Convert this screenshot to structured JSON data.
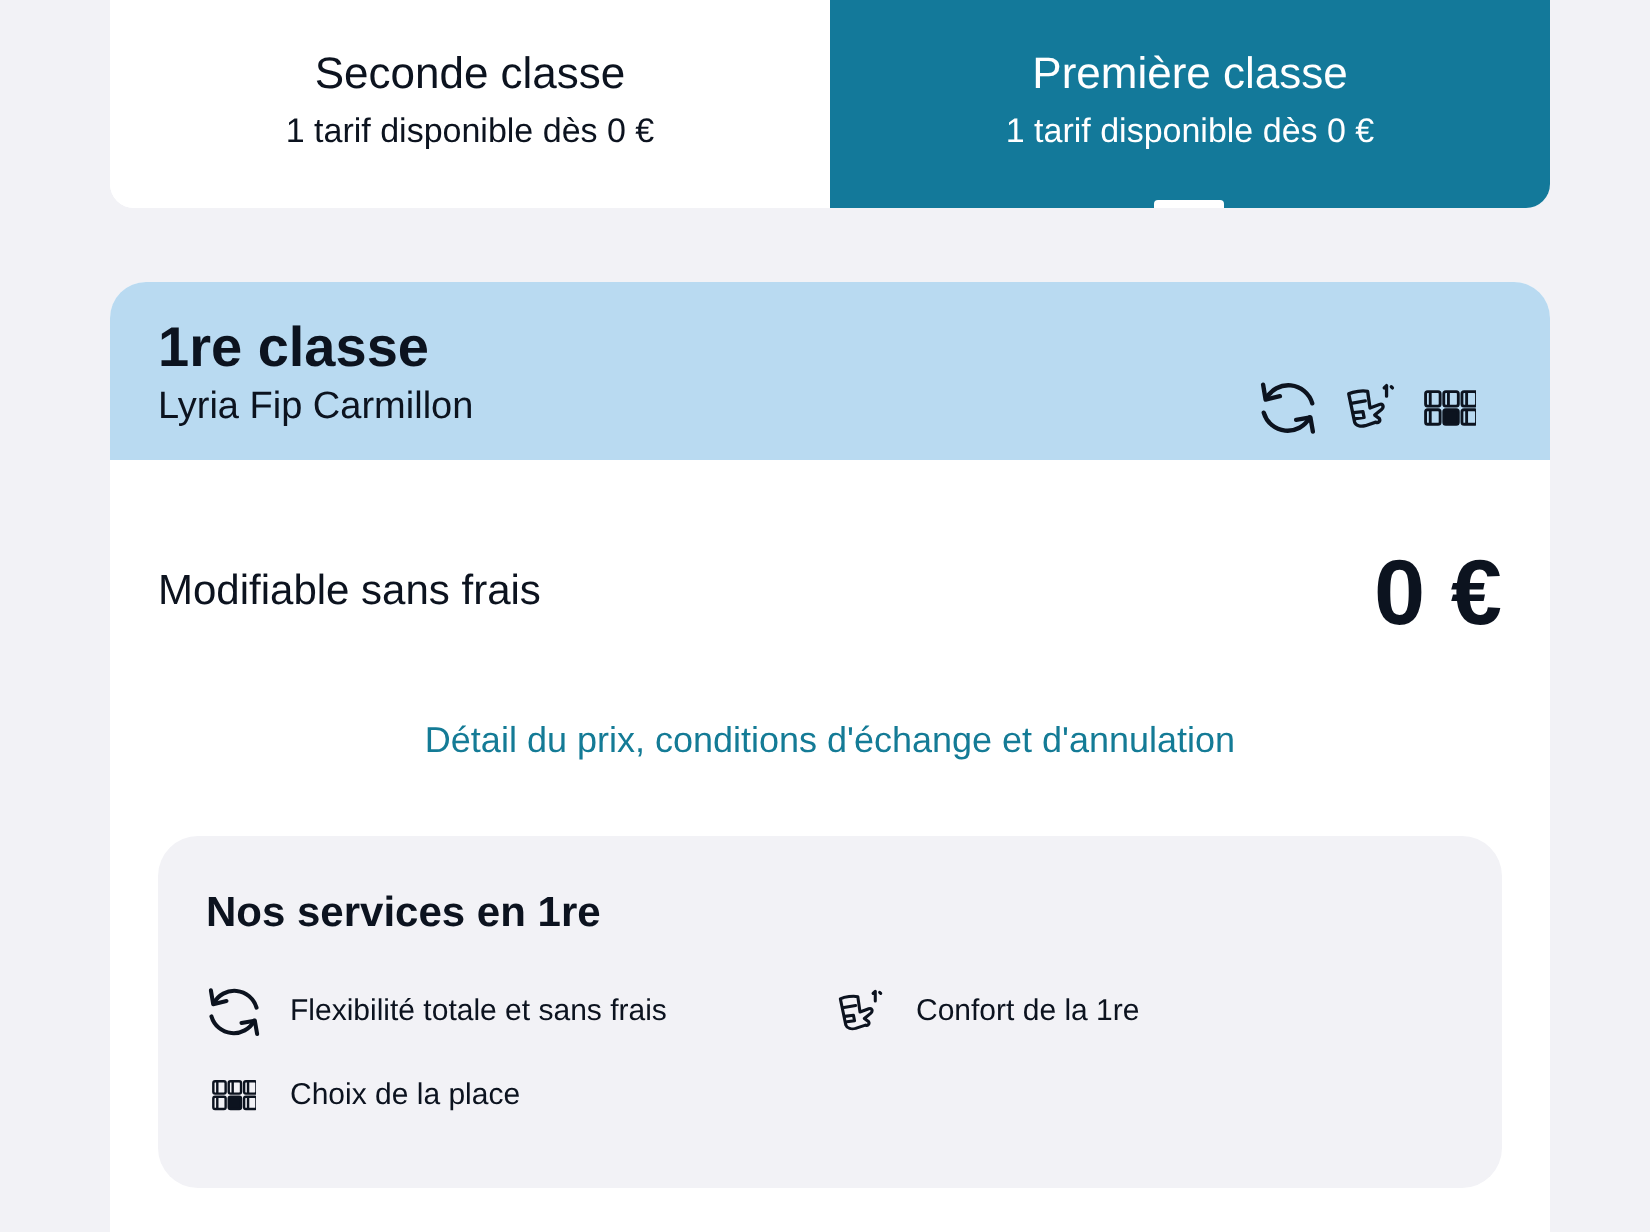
{
  "fare_tabs": [
    {
      "label": "Seconde classe",
      "subtitle": "1 tarif disponible dès 0 €",
      "selected": false
    },
    {
      "label": "Première classe",
      "subtitle": "1 tarif disponible dès 0 €",
      "selected": true
    }
  ],
  "fare_card": {
    "title": "1re classe",
    "subtitle": "Lyria Fip Carmillon",
    "condition": "Modifiable sans frais",
    "price": "0 €",
    "details_link": "Détail du prix, conditions d'échange et d'annulation",
    "services": {
      "title": "Nos services en 1re",
      "items": [
        {
          "kind": "flexibility",
          "label": "Flexibilité totale et sans frais"
        },
        {
          "kind": "comfort",
          "label": "Confort de la 1re"
        },
        {
          "kind": "seat",
          "label": "Choix de la place"
        }
      ]
    }
  }
}
